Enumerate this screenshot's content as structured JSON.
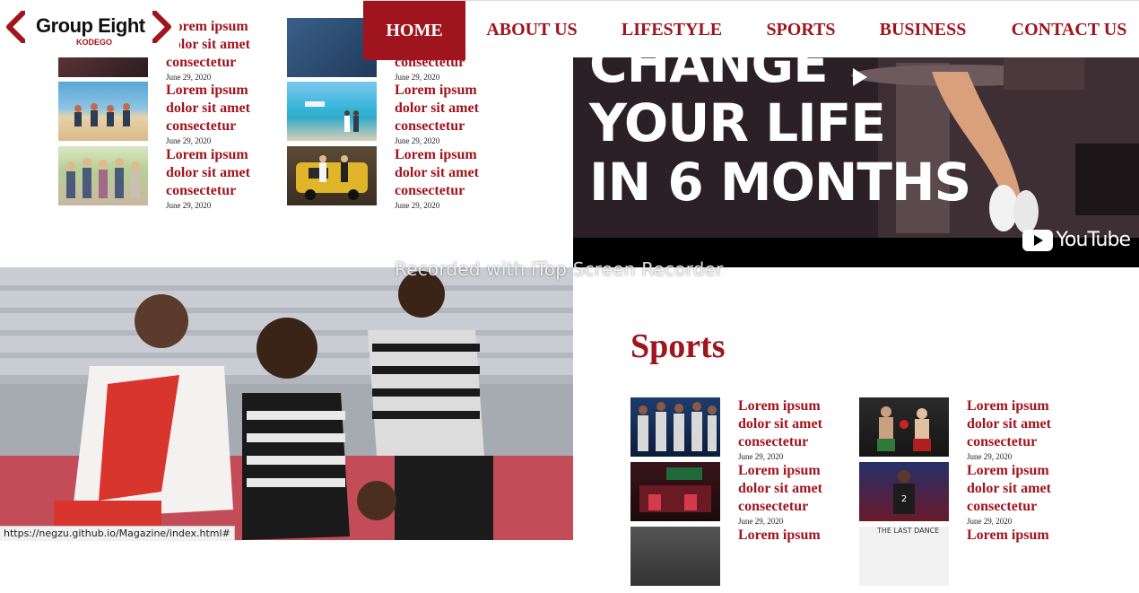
{
  "logo": {
    "name": "Group Eight",
    "subtitle": "KODEGO"
  },
  "nav": {
    "items": [
      {
        "label": "HOME",
        "active": true
      },
      {
        "label": "ABOUT US",
        "active": false
      },
      {
        "label": "LIFESTYLE",
        "active": false
      },
      {
        "label": "SPORTS",
        "active": false
      },
      {
        "label": "BUSINESS",
        "active": false
      },
      {
        "label": "CONTACT US",
        "active": false
      }
    ]
  },
  "lifestyle": {
    "articles": [
      {
        "title": "Lorem ipsum dolor sit amet consectetur",
        "date": "June 29, 2020"
      },
      {
        "title": "Lorem ipsum dolor sit amet consectetur",
        "date": "June 29, 2020"
      },
      {
        "title": "Lorem ipsum dolor sit amet consectetur",
        "date": "June 29, 2020"
      },
      {
        "title": "Lorem ipsum dolor sit amet consectetur",
        "date": "June 29, 2020"
      },
      {
        "title": "Lorem ipsum dolor sit amet consectetur",
        "date": "June 29, 2020"
      },
      {
        "title": "Lorem ipsum dolor sit amet consectetur",
        "date": "June 29, 2020"
      }
    ]
  },
  "video": {
    "line1": "CHANGE",
    "line2": "YOUR LIFE",
    "line3": "IN 6 MONTHS",
    "brand": "YouTube"
  },
  "sports": {
    "heading": "Sports",
    "articles": [
      {
        "title": "Lorem ipsum dolor sit amet consectetur",
        "date": "June 29, 2020"
      },
      {
        "title": "Lorem ipsum dolor sit amet consectetur",
        "date": "June 29, 2020"
      },
      {
        "title": "Lorem ipsum dolor sit amet consectetur",
        "date": "June 29, 2020"
      },
      {
        "title": "Lorem ipsum dolor sit amet consectetur",
        "date": "June 29, 2020"
      },
      {
        "title": "Lorem ipsum",
        "date": ""
      },
      {
        "title": "Lorem ipsum",
        "date": ""
      }
    ],
    "thumb_caption": "THE LAST DANCE"
  },
  "overlay": {
    "watermark": "Recorded with iTop Screen Recorder",
    "status_url": "https://negzu.github.io/Magazine/index.html#"
  },
  "colors": {
    "accent": "#a0141d",
    "text": "#111111",
    "white": "#ffffff"
  }
}
